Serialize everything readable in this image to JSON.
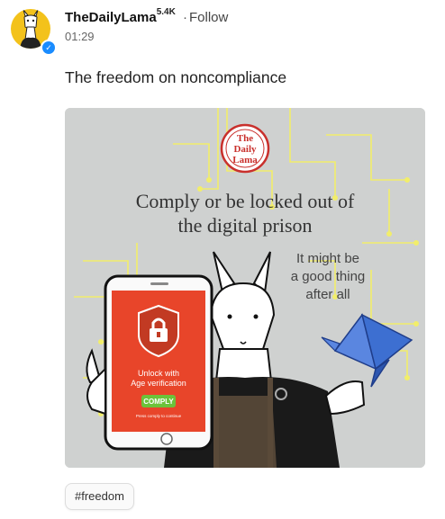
{
  "post": {
    "author": "TheDailyLama",
    "followers": "5.4K",
    "separator": "·",
    "follow_label": "Follow",
    "time": "01:29",
    "text": "The freedom on noncompliance",
    "hashtag": "#freedom"
  },
  "image": {
    "logo_lines": [
      "The",
      "Daily",
      "Lama"
    ],
    "headline_line1": "Comply or be locked out of",
    "headline_line2": "the digital prison",
    "side_line1": "It might be",
    "side_line2": "a good thing",
    "side_line3": "after all",
    "phone_line1": "Unlock with",
    "phone_line2": "Age verification",
    "comply_button": "COMPLY",
    "phone_small": "Press comply to continue"
  },
  "colors": {
    "avatar_bg": "#f3c21b",
    "verified": "#1a8cff",
    "phone_screen": "#e8452a",
    "comply_green": "#6cc23a",
    "crane_blue": "#3d6fd1",
    "circuit_yellow": "#f2ee6a"
  },
  "icons": [
    "llama-avatar-icon",
    "verified-check-icon",
    "padlock-icon",
    "paper-crane-icon"
  ]
}
